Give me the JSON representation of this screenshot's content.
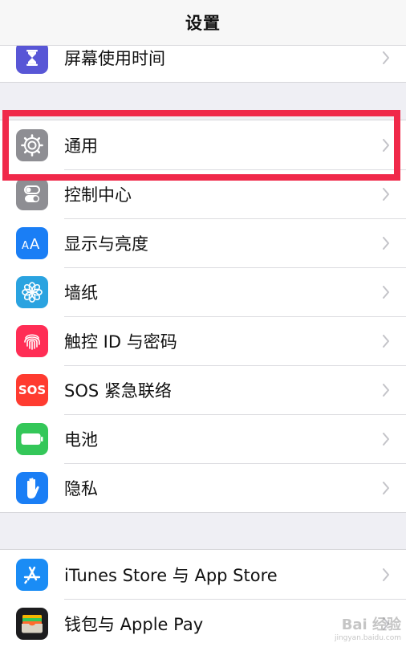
{
  "navbar": {
    "title": "设置"
  },
  "groups": {
    "top": {
      "items": [
        {
          "label": "屏幕使用时间",
          "icon": "hourglass-icon",
          "color": "#5856d6"
        }
      ]
    },
    "main": {
      "items": [
        {
          "label": "通用",
          "icon": "gear-icon",
          "color": "#8e8e93"
        },
        {
          "label": "控制中心",
          "icon": "toggles-icon",
          "color": "#8e8e93"
        },
        {
          "label": "显示与亮度",
          "icon": "text-size-icon",
          "color": "#1a7ef5"
        },
        {
          "label": "墙纸",
          "icon": "flower-icon",
          "color": "#2aa3e0"
        },
        {
          "label": "触控 ID 与密码",
          "icon": "fingerprint-icon",
          "color": "#ff2d55"
        },
        {
          "label": "SOS 紧急联络",
          "icon": "sos-icon",
          "color": "#ff3b30",
          "icon_text": "SOS"
        },
        {
          "label": "电池",
          "icon": "battery-icon",
          "color": "#34c759"
        },
        {
          "label": "隐私",
          "icon": "hand-icon",
          "color": "#1a7ef5"
        }
      ]
    },
    "store": {
      "items": [
        {
          "label": "iTunes Store 与 App Store",
          "icon": "app-store-icon",
          "color": "#1a8cf5"
        },
        {
          "label": "钱包与 Apple Pay",
          "icon": "wallet-icon",
          "color": "#1c1c1e"
        }
      ]
    }
  },
  "highlight": {
    "color": "#f0294a"
  },
  "watermark": {
    "text": "Bai 经验",
    "sub": "jingyan.baidu.com"
  }
}
